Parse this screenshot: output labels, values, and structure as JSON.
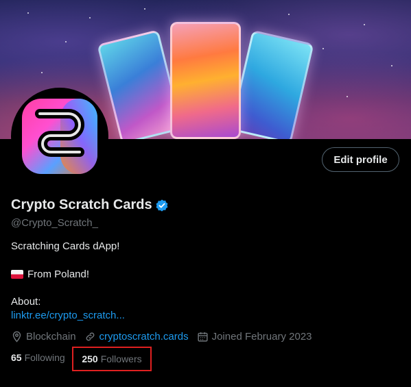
{
  "profile": {
    "display_name": "Crypto Scratch Cards",
    "handle": "@Crypto_Scratch_",
    "verified_icon": "verified-badge-icon",
    "edit_button_label": "Edit profile",
    "bio": {
      "line1": "Scratching Cards dApp!",
      "line2": "From Poland!",
      "line2_icon": "poland-flag-icon",
      "about_label": "About:",
      "about_link": "linktr.ee/crypto_scratch..."
    },
    "meta": {
      "category": "Blockchain",
      "category_icon": "location-pin-icon",
      "website": "cryptoscratch.cards",
      "website_icon": "link-icon",
      "joined": "Joined February 2023",
      "joined_icon": "calendar-icon"
    },
    "stats": {
      "following_count": "65",
      "following_label": "Following",
      "followers_count": "250",
      "followers_label": "Followers"
    }
  },
  "colors": {
    "accent": "#1d9bf0",
    "background": "#000000",
    "text_primary": "#e7e9ea",
    "text_secondary": "#71767b",
    "highlight_box": "#e02020"
  }
}
